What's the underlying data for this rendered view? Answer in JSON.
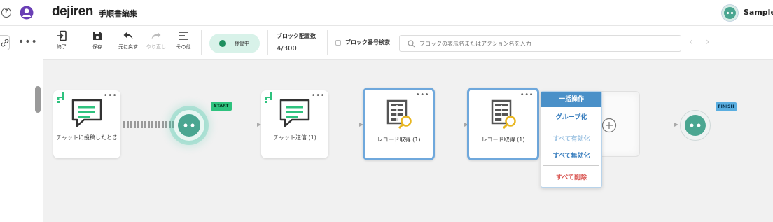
{
  "app": {
    "logo": "dejiren",
    "page_title": "手順書編集",
    "account_name": "Sample_"
  },
  "icons": {
    "help": "help-circle-icon",
    "user": "user-icon",
    "link": "link-icon",
    "more": "more-horizontal-icon",
    "search": "search-icon"
  },
  "colors": {
    "accent": "#4a90c8",
    "running": "#1f8f5f",
    "running_bg": "#d8f2e9",
    "start_tag": "#2ec27e",
    "finish_tag": "#5aaee0",
    "danger": "#d9534f",
    "selected_border": "#6fa8dc"
  },
  "toolbar": {
    "exit_label": "終了",
    "save_label": "保存",
    "undo_label": "元に戻す",
    "redo_label": "やり直し",
    "other_label": "その他",
    "status_label": "稼働中",
    "block_count_label": "ブロック配置数",
    "block_count_value": "4/300",
    "block_number_search_label": "ブロック番号検索",
    "search_placeholder": "ブロックの表示名またはアクション名を入力",
    "prev_label": "‹",
    "next_label": "›"
  },
  "flow": {
    "start_tag": "START",
    "finish_tag": "FINISH",
    "blocks": [
      {
        "title": "チャットに投稿したとき",
        "icon": "chat-icon",
        "selected": false
      },
      {
        "title": "チャット送信 (1)",
        "icon": "chat-icon",
        "selected": false
      },
      {
        "title": "レコード取得 (1)",
        "icon": "table-search-icon",
        "selected": true
      },
      {
        "title": "レコード取得 (1)",
        "icon": "table-search-icon",
        "selected": true
      }
    ]
  },
  "context_menu": {
    "header": "一括操作",
    "items": [
      {
        "label": "グループ化",
        "enabled": true
      },
      {
        "label": "すべて有効化",
        "enabled": false
      },
      {
        "label": "すべて無効化",
        "enabled": true
      },
      {
        "label": "すべて削除",
        "enabled": true
      }
    ]
  }
}
